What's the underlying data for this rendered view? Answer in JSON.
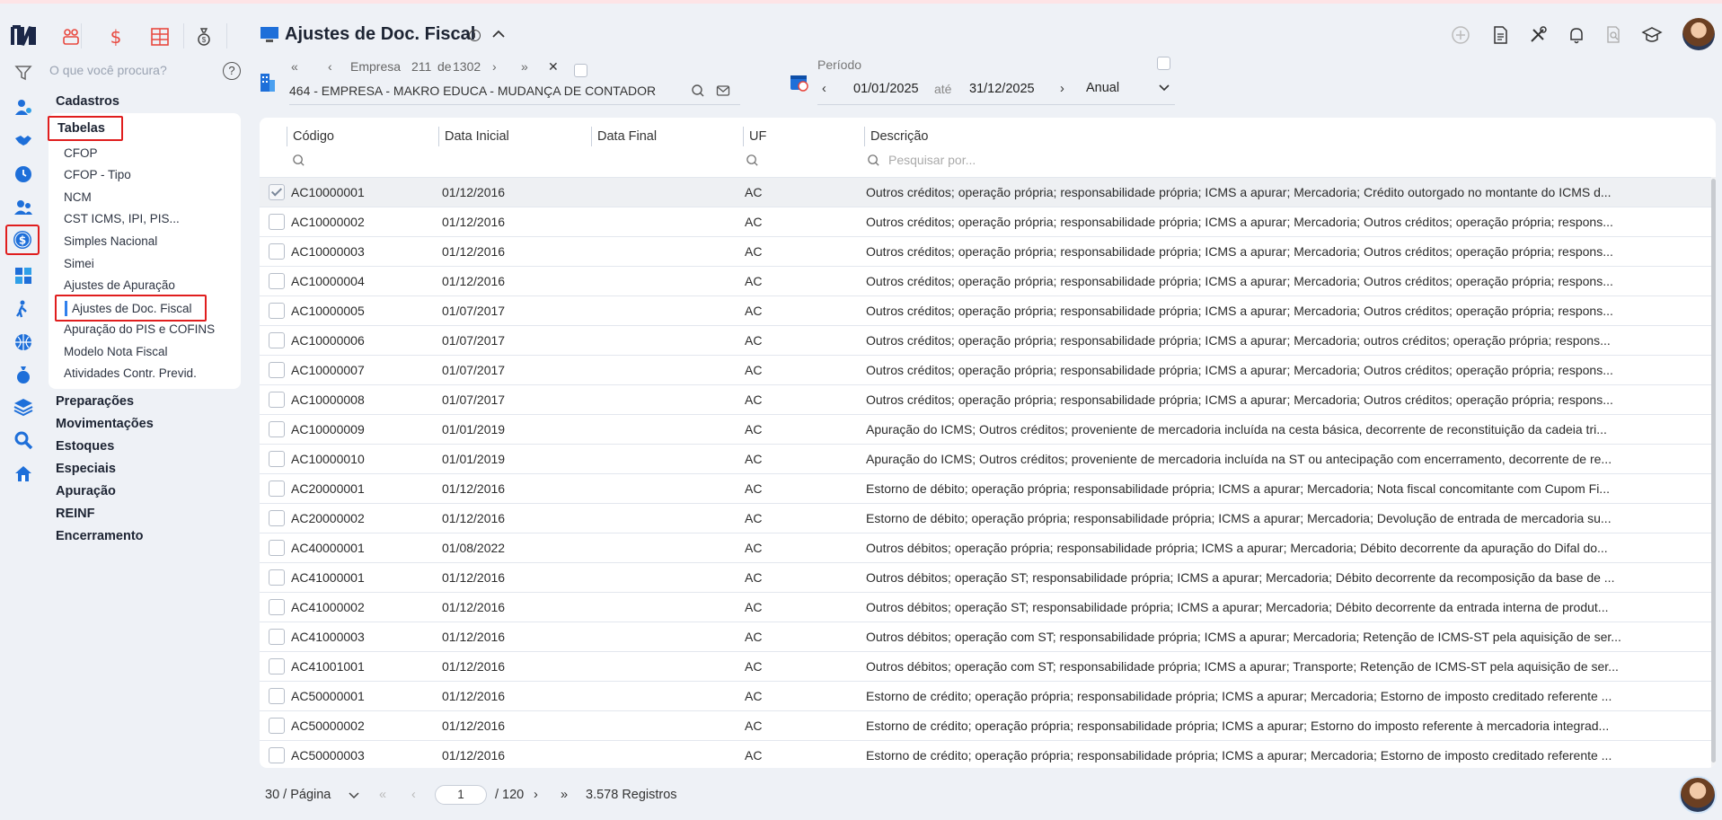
{
  "app": {
    "search_placeholder": "O que você procura?",
    "help": "?"
  },
  "menu": {
    "cadastros": "Cadastros",
    "tabelas": "Tabelas",
    "tabelas_items": [
      "CFOP",
      "CFOP - Tipo",
      "NCM",
      "CST ICMS, IPI, PIS...",
      "Simples Nacional",
      "Simei",
      "Ajustes de Apuração",
      "Ajustes de Doc. Fiscal",
      "Apuração do PIS e COFINS",
      "Modelo Nota Fiscal",
      "Atividades Contr. Previd."
    ],
    "sections": [
      "Preparações",
      "Movimentações",
      "Estoques",
      "Especiais",
      "Apuração",
      "REINF",
      "Encerramento"
    ]
  },
  "rail_icons": [
    "users-icon",
    "handshake-icon",
    "clock-icon",
    "team-icon",
    "dollar-icon",
    "calculator-icon",
    "walker-icon",
    "globe-icon",
    "money-bag-icon",
    "layers-icon",
    "search-icon",
    "home-icon"
  ],
  "header": {
    "title": "Ajustes de Doc. Fiscal",
    "info": "i"
  },
  "empresa": {
    "label": "Empresa",
    "index": "211",
    "of": "de",
    "total": "1302",
    "name": "464 - EMPRESA - MAKRO EDUCA - MUDANÇA DE CONTADOR"
  },
  "periodo": {
    "label": "Período",
    "start": "01/01/2025",
    "ate": "até",
    "end": "31/12/2025",
    "mode": "Anual"
  },
  "table": {
    "columns": [
      "Código",
      "Data Inicial",
      "Data Final",
      "UF",
      "Descrição"
    ],
    "filter_placeholder": "Pesquisar por...",
    "rows": [
      {
        "codigo": "AC10000001",
        "data_inicial": "01/12/2016",
        "data_final": "",
        "uf": "AC",
        "descricao": "Outros créditos; operação própria; responsabilidade própria; ICMS a apurar; Mercadoria; Crédito outorgado no montante do ICMS d...",
        "checked": true
      },
      {
        "codigo": "AC10000002",
        "data_inicial": "01/12/2016",
        "data_final": "",
        "uf": "AC",
        "descricao": "Outros créditos; operação própria; responsabilidade própria; ICMS a apurar; Mercadoria; Outros créditos; operação própria; respons..."
      },
      {
        "codigo": "AC10000003",
        "data_inicial": "01/12/2016",
        "data_final": "",
        "uf": "AC",
        "descricao": "Outros créditos; operação própria; responsabilidade própria; ICMS a apurar; Mercadoria; Outros créditos; operação própria; respons..."
      },
      {
        "codigo": "AC10000004",
        "data_inicial": "01/12/2016",
        "data_final": "",
        "uf": "AC",
        "descricao": "Outros créditos; operação própria; responsabilidade própria; ICMS a apurar; Mercadoria; Outros créditos; operação própria; respons..."
      },
      {
        "codigo": "AC10000005",
        "data_inicial": "01/07/2017",
        "data_final": "",
        "uf": "AC",
        "descricao": "Outros créditos; operação própria; responsabilidade própria; ICMS a apurar; Mercadoria; Outros créditos; operação própria; respons..."
      },
      {
        "codigo": "AC10000006",
        "data_inicial": "01/07/2017",
        "data_final": "",
        "uf": "AC",
        "descricao": "Outros créditos; operação própria; responsabilidade própria; ICMS a apurar; Mercadoria; outros créditos; operação própria; respons..."
      },
      {
        "codigo": "AC10000007",
        "data_inicial": "01/07/2017",
        "data_final": "",
        "uf": "AC",
        "descricao": "Outros créditos; operação própria; responsabilidade própria; ICMS a apurar; Mercadoria; Outros créditos; operação própria; respons..."
      },
      {
        "codigo": "AC10000008",
        "data_inicial": "01/07/2017",
        "data_final": "",
        "uf": "AC",
        "descricao": "Outros créditos; operação própria; responsabilidade própria; ICMS a apurar; Mercadoria; Outros créditos; operação própria; respons..."
      },
      {
        "codigo": "AC10000009",
        "data_inicial": "01/01/2019",
        "data_final": "",
        "uf": "AC",
        "descricao": "Apuração do ICMS; Outros créditos; proveniente de mercadoria incluída na cesta básica, decorrente de reconstituição da cadeia tri..."
      },
      {
        "codigo": "AC10000010",
        "data_inicial": "01/01/2019",
        "data_final": "",
        "uf": "AC",
        "descricao": "Apuração do ICMS; Outros créditos; proveniente de mercadoria incluída na ST ou antecipação com encerramento, decorrente de re..."
      },
      {
        "codigo": "AC20000001",
        "data_inicial": "01/12/2016",
        "data_final": "",
        "uf": "AC",
        "descricao": "Estorno de débito; operação própria; responsabilidade própria; ICMS a apurar; Mercadoria; Nota fiscal concomitante com Cupom Fi..."
      },
      {
        "codigo": "AC20000002",
        "data_inicial": "01/12/2016",
        "data_final": "",
        "uf": "AC",
        "descricao": "Estorno de débito; operação própria; responsabilidade própria; ICMS a apurar; Mercadoria; Devolução de entrada de mercadoria su..."
      },
      {
        "codigo": "AC40000001",
        "data_inicial": "01/08/2022",
        "data_final": "",
        "uf": "AC",
        "descricao": "Outros débitos; operação própria; responsabilidade própria; ICMS a apurar; Mercadoria; Débito decorrente da apuração do Difal do..."
      },
      {
        "codigo": "AC41000001",
        "data_inicial": "01/12/2016",
        "data_final": "",
        "uf": "AC",
        "descricao": "Outros débitos; operação ST; responsabilidade própria; ICMS a apurar; Mercadoria; Débito decorrente da recomposição da base de ..."
      },
      {
        "codigo": "AC41000002",
        "data_inicial": "01/12/2016",
        "data_final": "",
        "uf": "AC",
        "descricao": "Outros débitos; operação ST; responsabilidade própria; ICMS a apurar; Mercadoria; Débito decorrente da entrada interna de produt..."
      },
      {
        "codigo": "AC41000003",
        "data_inicial": "01/12/2016",
        "data_final": "",
        "uf": "AC",
        "descricao": "Outros débitos; operação com ST; responsabilidade própria; ICMS a apurar; Mercadoria; Retenção de ICMS-ST pela aquisição de ser..."
      },
      {
        "codigo": "AC41001001",
        "data_inicial": "01/12/2016",
        "data_final": "",
        "uf": "AC",
        "descricao": "Outros débitos; operação com ST; responsabilidade própria; ICMS a apurar; Transporte; Retenção de ICMS-ST pela aquisição de ser..."
      },
      {
        "codigo": "AC50000001",
        "data_inicial": "01/12/2016",
        "data_final": "",
        "uf": "AC",
        "descricao": "Estorno de crédito; operação própria; responsabilidade própria; ICMS a apurar; Mercadoria; Estorno de imposto creditado referente ..."
      },
      {
        "codigo": "AC50000002",
        "data_inicial": "01/12/2016",
        "data_final": "",
        "uf": "AC",
        "descricao": "Estorno de crédito; operação própria; responsabilidade própria; ICMS a apurar; Estorno do imposto referente à mercadoria integrad..."
      },
      {
        "codigo": "AC50000003",
        "data_inicial": "01/12/2016",
        "data_final": "",
        "uf": "AC",
        "descricao": "Estorno de crédito; operação própria; responsabilidade própria; ICMS a apurar; Mercadoria; Estorno de imposto creditado referente ..."
      }
    ]
  },
  "pagination": {
    "per_page": "30 / Página",
    "page": "1",
    "of_pages": "/ 120",
    "records": "3.578 Registros"
  },
  "colors": {
    "accent": "#2f80ed",
    "highlight_border": "#e01e1e",
    "top_icons_red": "#e8483f",
    "rail_blue": "#1e6fd9"
  }
}
